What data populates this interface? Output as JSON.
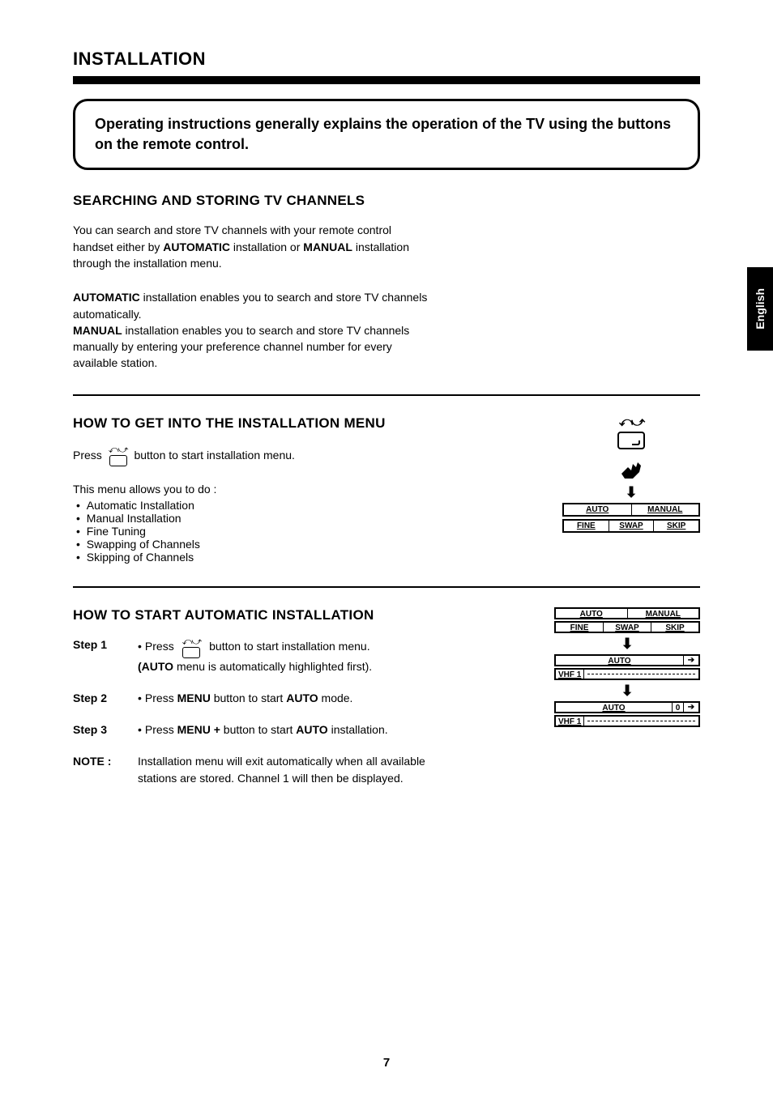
{
  "language_tab": "English",
  "section_title": "INSTALLATION",
  "intro": "Operating instructions generally explains the operation of the TV using the buttons on the remote control.",
  "s1": {
    "heading": "SEARCHING AND STORING TV CHANNELS",
    "p1_a": "You can search and store TV channels with your remote control handset  either by ",
    "p1_b": "AUTOMATIC",
    "p1_c": " installation or ",
    "p1_d": "MANUAL",
    "p1_e": " installation through the installation menu.",
    "p2_a": "AUTOMATIC",
    "p2_b": " installation enables you to search and store TV channels automatically.",
    "p2_c": "MANUAL",
    "p2_d": " installation enables you to search and store TV channels manually by entering your preference channel number for every available  station."
  },
  "s2": {
    "heading": "HOW TO GET INTO THE INSTALLATION MENU",
    "press_a": "Press",
    "press_b": "button to start installation menu.",
    "intro": "This menu allows you to do :",
    "items": [
      "Automatic Installation",
      "Manual Installation",
      "Fine Tuning",
      "Swapping of Channels",
      "Skipping of Channels"
    ],
    "osd_row1": [
      "AUTO",
      "MANUAL"
    ],
    "osd_row2": [
      "FINE",
      "SWAP",
      "SKIP"
    ]
  },
  "s3": {
    "heading": "HOW TO START AUTOMATIC INSTALLATION",
    "step1_label": "Step 1",
    "step1_a": "Press",
    "step1_b": "button to start installation menu.",
    "step1_c": "(AUTO",
    "step1_d": " menu is automatically highlighted first).",
    "step2_label": "Step 2",
    "step2_a": "Press ",
    "step2_b": "MENU",
    "step2_c": " button to start ",
    "step2_d": "AUTO",
    "step2_e": " mode.",
    "step3_label": "Step 3",
    "step3_a": "Press ",
    "step3_b": "MENU +",
    "step3_c": " button to start ",
    "step3_d": "AUTO",
    "step3_e": " installation.",
    "note_label": "NOTE :",
    "note_text": "Installation menu will exit automatically when all available stations are stored. Channel 1 will then be displayed.",
    "osd": {
      "r1": [
        "AUTO",
        "MANUAL"
      ],
      "r2": [
        "FINE",
        "SWAP",
        "SKIP"
      ],
      "r3_auto": "AUTO",
      "r3_vhf": "VHF 1",
      "r4_auto": "AUTO",
      "r4_zero": "0",
      "r4_vhf": "VHF 1"
    }
  },
  "page_number": "7"
}
